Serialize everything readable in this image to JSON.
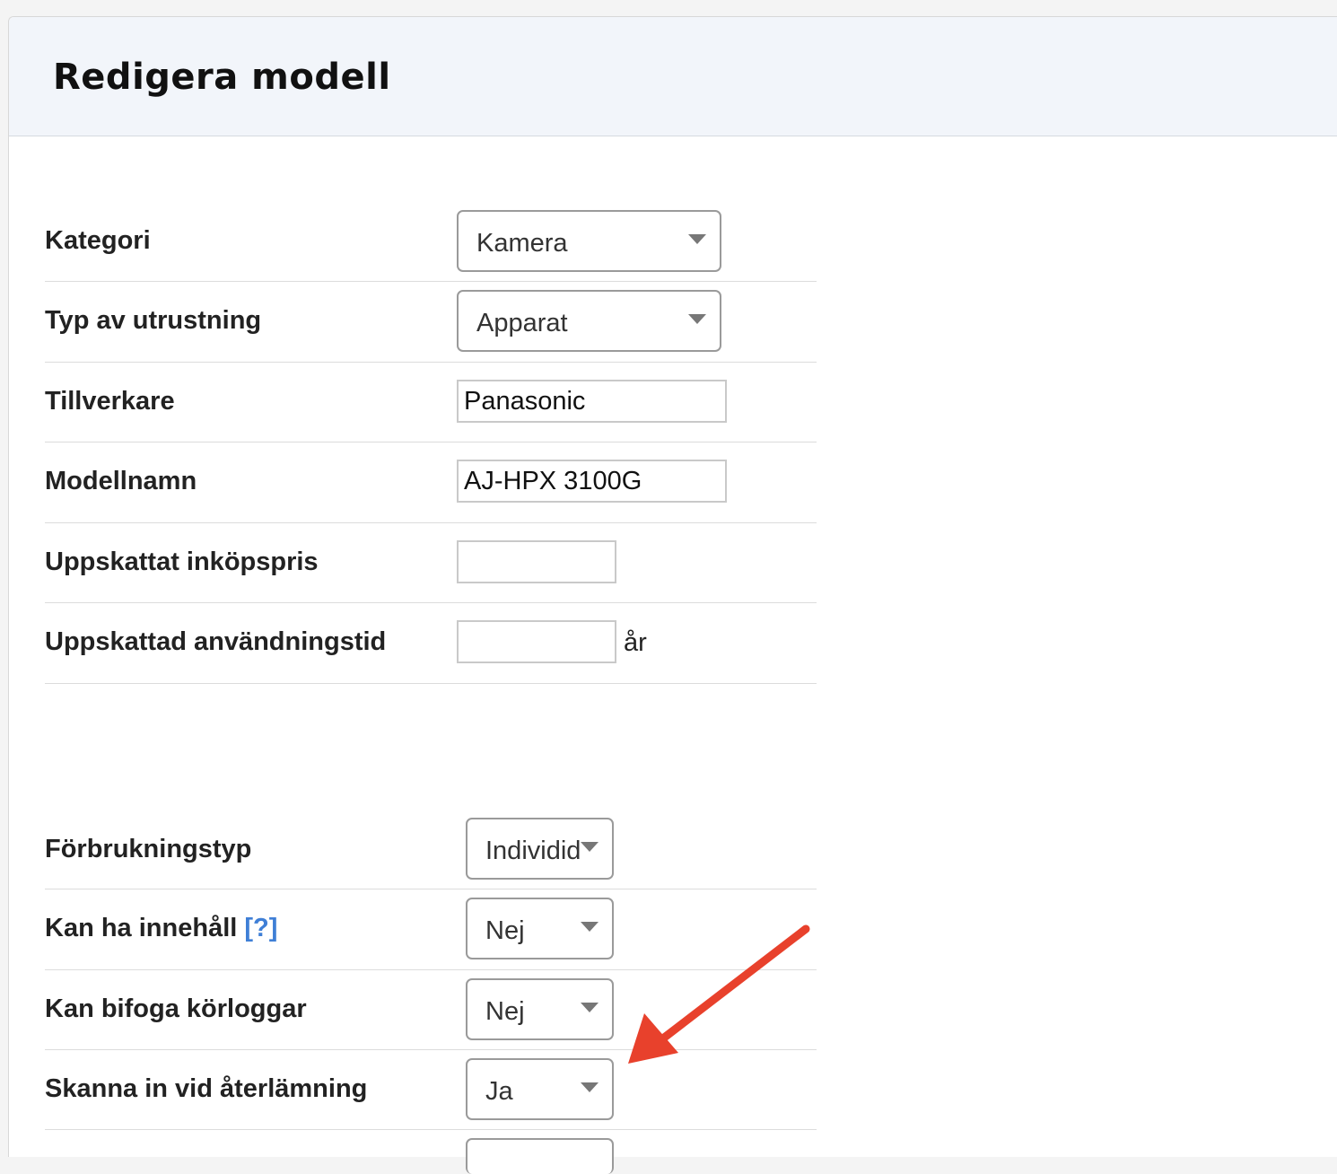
{
  "header": {
    "title": "Redigera modell"
  },
  "form_top": {
    "kategori": {
      "label": "Kategori",
      "value": "Kamera"
    },
    "typ": {
      "label": "Typ av utrustning",
      "value": "Apparat"
    },
    "tillverkare": {
      "label": "Tillverkare",
      "value": "Panasonic"
    },
    "modellnamn": {
      "label": "Modellnamn",
      "value": "AJ-HPX 3100G"
    },
    "inkopspris": {
      "label": "Uppskattat inköpspris",
      "value": ""
    },
    "anvandningstid": {
      "label": "Uppskattad användningstid",
      "value": "",
      "unit": "år"
    }
  },
  "form_bottom": {
    "forbrukningstyp": {
      "label": "Förbrukningstyp",
      "value": "Individid"
    },
    "innehall": {
      "label": "Kan ha innehåll",
      "help": "[?]",
      "value": "Nej"
    },
    "korloggar": {
      "label": "Kan bifoga körloggar",
      "value": "Nej"
    },
    "skanna": {
      "label": "Skanna in vid återlämning",
      "value": "Ja"
    }
  },
  "annotation": {
    "arrow_color": "#e8412c",
    "icon": "red-arrow-icon"
  },
  "colors": {
    "header_bg": "#f2f5fa",
    "link": "#3f7fd6"
  }
}
